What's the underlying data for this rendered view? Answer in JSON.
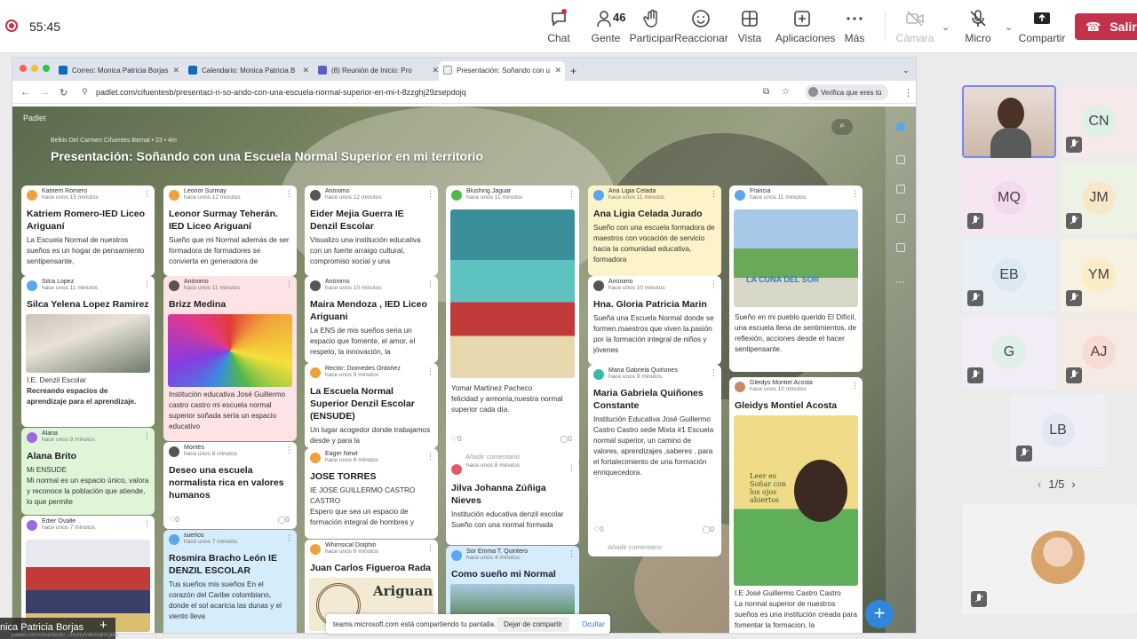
{
  "meeting": {
    "timer": "55:45",
    "toolbar": [
      {
        "label": "Chat",
        "icon": "chat-icon"
      },
      {
        "label": "Gente",
        "icon": "people-icon",
        "count": "46"
      },
      {
        "label": "Participar",
        "icon": "hand-icon"
      },
      {
        "label": "Reaccionar",
        "icon": "smile-icon"
      },
      {
        "label": "Vista",
        "icon": "grid-icon"
      },
      {
        "label": "Aplicaciones",
        "icon": "plus-box-icon"
      },
      {
        "label": "Más",
        "icon": "more-icon"
      },
      {
        "label": "Cámara",
        "icon": "camera-off-icon"
      },
      {
        "label": "Micro",
        "icon": "mic-off-icon"
      },
      {
        "label": "Compartir",
        "icon": "share-icon"
      }
    ],
    "leave_label": "Salir",
    "presenter_name": "nica Patricia Borjas",
    "share_notice": "teams.microsoft.com está compartiendo tu pantalla.",
    "stop_sharing": "Dejar de compartir",
    "hide": "Ocultar",
    "pager": "1/5",
    "participants": [
      "CN",
      "MQ",
      "JM",
      "EB",
      "YM",
      "G",
      "AJ",
      "LB"
    ],
    "accent": "#c4314b"
  },
  "browser": {
    "tabs": [
      "Correo: Monica Patricia Borjas",
      "Calendario: Monica Patricia B",
      "(8) Reunión de Inicio: Pro",
      "Presentación: Soñando con u"
    ],
    "url": "padlet.com/cifuentesb/presentaci-n-so-ando-con-una-escuela-normal-superior-en-mi-t-8zzghj29zsepdojq",
    "verify": "Verifica que eres tú",
    "status_url": "padlet.com/cifuentesb/...mDRvV4bzG8VQib1"
  },
  "padlet": {
    "brand": "Padlet",
    "author": "Belkis Del Carmen Cifuentes Bernal • 23 • 4m",
    "title": "Presentación: Soñando con una Escuela Normal Superior en mi territorio",
    "columns": [
      [
        {
          "name": "Katriem Romero",
          "time": "hace unos 15 minutos",
          "title": "Katriem Romero-IED Liceo Ariguaní",
          "body": "La Escuela Normal de nuestros sueños es un hogar de pensamiento sentipensante,"
        },
        {
          "name": "Silca Lopez",
          "time": "hace unos 11 minutos",
          "title": "Silca Yelena Lopez Ramirez",
          "body": "I.E. Denzil Escolar",
          "body2": "Recreando espacios de aprendizaje para el aprendizaje."
        },
        {
          "name": "Alana",
          "time": "hace unos 9 minutos",
          "title": "Alana Brito",
          "body": "Mi ENSUDE",
          "body2": "Mi normal es un espacio único, valora y reconoce la población que atiende, lo que permite"
        },
        {
          "name": "Edier Ovalle",
          "time": "hace unos 7 minutos",
          "title": "",
          "body": ""
        }
      ],
      [
        {
          "name": "Leonor Surmay",
          "time": "hace unos 12 minutos",
          "title": "Leonor Surmay Teherán. IED Liceo Ariguaní",
          "body": "Sueño que mi Normal además de ser formadora de formadores se convierta en generadora de"
        },
        {
          "name": "Anónimo",
          "time": "hace unos 11 minutos",
          "title": "Brizz Medina",
          "body": "Institución educativa José Guillermo castro castro mi escuela normal superior soñada sería un espacio educativo"
        },
        {
          "name": "Montés",
          "time": "hace unos 8 minutos",
          "title": "Deseo una escuela normalista rica en valores humanos",
          "body": ""
        },
        {
          "name": "sueños",
          "time": "hace unos 7 minutos",
          "title": "Rosmira Bracho León IE DENZIL ESCOLAR",
          "body": "Tus sueños mis sueños En el corazón del Caribe colombiano, donde el sol acaricia las dunas y el viento lleva"
        }
      ],
      [
        {
          "name": "Anónimo",
          "time": "hace unos 12 minutos",
          "title": "Eider Mejia Guerra IE Denzil Escolar",
          "body": "Visualizo una institución educativa con un fuerte arraigo cultural, compromiso social y una"
        },
        {
          "name": "Anónimo",
          "time": "hace unos 10 minutos",
          "title": "Maira Mendoza , IED Liceo Ariguani",
          "body": "La ENS de mis sueños seria un espacio que fomente, el amor, el respeto, la innovación, la"
        },
        {
          "name": "Rector: Diomedes Ordóñez",
          "time": "hace unos 9 minutos",
          "title": "La Escuela Normal Superior Denzil Escolar (ENSUDE)",
          "body": "Un lugar acogedor donde trabajamos desde y para la"
        },
        {
          "name": "Eager Newt",
          "time": "hace unos 8 minutos",
          "title": "JOSE TORRES",
          "body": "IE JOSE GUILLERMO CASTRO CASTRO",
          "body2": "Espero que sea un espacio de formación integral de hombres y"
        },
        {
          "name": "Whimsical Dolphin",
          "time": "hace unos 6 minutos",
          "title": "Juan Carlos Figueroa Rada",
          "body": "Ariguaní"
        }
      ],
      [
        {
          "name": "Blushing Jaguar",
          "time": "hace unos 11 minutos",
          "title": "",
          "body": "Yomar Martinez Pacheco",
          "body2": "felicidad y armonía,nuestra normal superior cada día.",
          "comment": "Añadir comentario",
          "likes": "0",
          "comments": "0"
        },
        {
          "name": "",
          "time": "hace unos 8 minutos",
          "title": "Jilva Johanna Zúñiga Nieves",
          "body": "Institución educativa denzil escolar",
          "body2": "Sueño con una normal formada"
        },
        {
          "name": "Sor Emma T. Quintero",
          "time": "hace unos 4 minutos",
          "title": "Como sueño mi Normal",
          "body": ""
        }
      ],
      [
        {
          "name": "Ana Ligia Celada",
          "time": "hace unos 11 minutos",
          "title": "Ana Ligia Celada Jurado",
          "body": "Sueño con una escuela formadora de maestros con vocación de servicio hacia la comunidad educativa, formadora"
        },
        {
          "name": "Anónimo",
          "time": "hace unos 10 minutos",
          "title": "Hna. Gloria Patricia Marin",
          "body": "Sueña una Escuela Normal donde se formen.maestros que viven la.pasión por la formación integral de niños y jóvenes"
        },
        {
          "name": "Maria Gabriela Quiñones",
          "time": "hace unos 9 minutos",
          "title": "Maria Gabriela Quiñones Constante",
          "body": "Institución Educativa José Guillermo Castro Castro sede Mixta #1 Escuela normal superior, un camino de valores, aprendizajes ,saberes , para el fortalecimiento de una formación enriquecedora.",
          "comment": "Añadir comentario",
          "likes": "0",
          "comments": "0"
        }
      ],
      [
        {
          "name": "Francia",
          "time": "hace unos 11 minutos",
          "title": "",
          "body": "Sueño en mi pueblo querido El Difícil, una escuela llena de sentimientos, de reflexión, acciones desde el hacer sentipensante.",
          "img_text": "LA CUNA DEL SOR"
        },
        {
          "name": "Gleidys Montiel Acosta",
          "time": "hace unos 10 minutos",
          "title": "Gleidys Montiel Acosta",
          "body": "I.E José Guillermo Castro Castro",
          "body2": "La normal superior de nuestros sueños es una institución creada para fomentar la formacion, la",
          "img_text": "Leer es Soñar con los ojos abiertos"
        }
      ]
    ]
  }
}
